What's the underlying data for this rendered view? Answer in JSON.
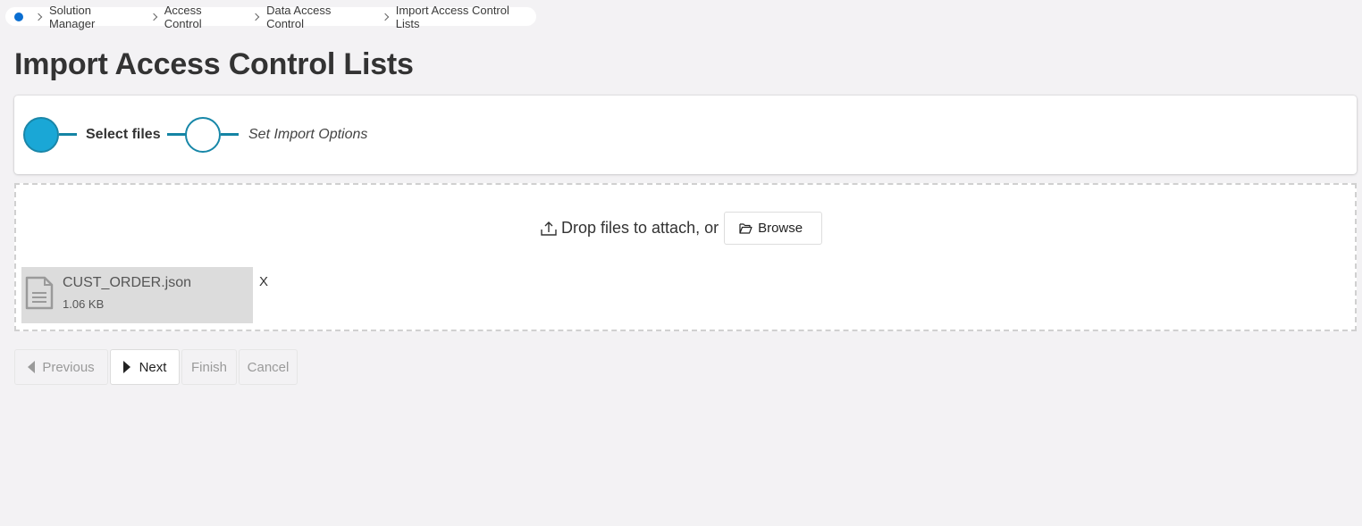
{
  "breadcrumb": {
    "items": [
      "Solution Manager",
      "Access Control",
      "Data Access Control",
      "Import Access Control Lists"
    ]
  },
  "page": {
    "title": "Import Access Control Lists"
  },
  "wizard": {
    "steps": [
      {
        "label": "Select files",
        "state": "active"
      },
      {
        "label": "Set Import Options",
        "state": "inactive"
      }
    ],
    "accent_color": "#1aa7d6"
  },
  "dropzone": {
    "prompt": "Drop files to attach, or",
    "browse_label": "Browse",
    "files": [
      {
        "name": "CUST_ORDER.json",
        "size": "1.06 KB",
        "remove_label": "X"
      }
    ]
  },
  "footer": {
    "previous_label": "Previous",
    "next_label": "Next",
    "finish_label": "Finish",
    "cancel_label": "Cancel"
  }
}
